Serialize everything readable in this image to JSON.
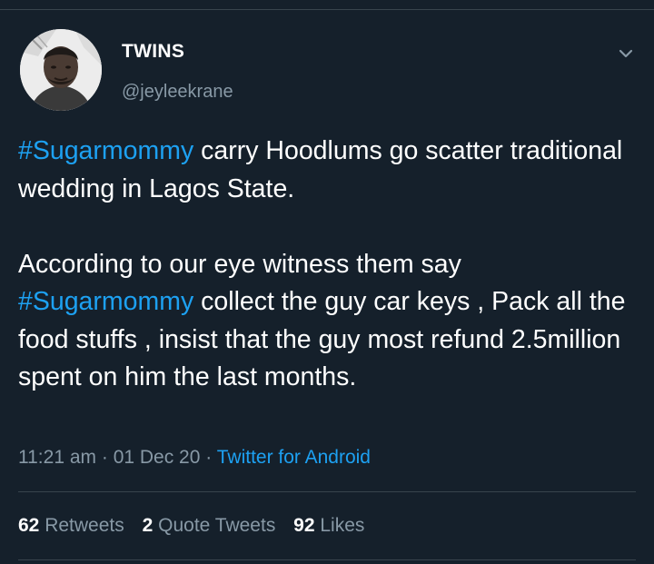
{
  "author": {
    "name": "TWINS",
    "handle": "@jeyleekrane"
  },
  "tweet": {
    "para1": {
      "hashtag": "#Sugarmommy",
      "text": " carry Hoodlums go scatter traditional wedding in Lagos State."
    },
    "para2": {
      "lead": "According to our eye witness them say ",
      "hashtag": "#Sugarmommy",
      "text": " collect the guy car keys , Pack all the food stuffs , insist that the guy most refund 2.5million spent on him the last months."
    }
  },
  "meta": {
    "time": "11:21 am",
    "separator": "·",
    "date": "01 Dec 20",
    "source": "Twitter for Android"
  },
  "stats": {
    "retweets": {
      "count": "62",
      "label": "Retweets"
    },
    "quotes": {
      "count": "2",
      "label": "Quote Tweets"
    },
    "likes": {
      "count": "92",
      "label": "Likes"
    }
  },
  "icons": {
    "menu": "chevron-down-icon",
    "avatar": "avatar-photo"
  },
  "colors": {
    "background": "#15202b",
    "text": "#ffffff",
    "secondary": "#8899a6",
    "accent": "#1da1f2",
    "divider": "#38444d"
  }
}
